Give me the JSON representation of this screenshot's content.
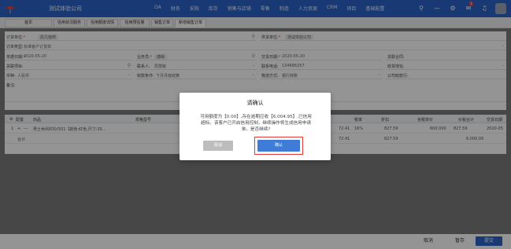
{
  "header": {
    "company": "测试体验公司",
    "nav": [
      "OA",
      "财务",
      "采购",
      "库存",
      "销售与店铺",
      "零售",
      "制造",
      "人力资源",
      "CRM",
      "项目",
      "基础配置"
    ],
    "notification_count": "1"
  },
  "tabs": [
    "首页",
    "信用状况服务",
    "信用额度详情",
    "信用预估量",
    "销售订单",
    "新增销售订单"
  ],
  "form": {
    "order_unit_label": "订货单位:",
    "order_unit_value": "凯凡拖呀",
    "supply_unit_label": "供货单位:",
    "supply_unit_value": "测试体验公司",
    "order_type_label": "订单类型:",
    "order_type_value": "标准客户订货单",
    "order_date_label": "单据日期:",
    "order_date_value": "2020-05-20",
    "salesperson_label": "业务员:",
    "salesperson_value": "傅缘",
    "delivery_date_label": "交货日期:",
    "delivery_date_value": "2020-05-20",
    "contract_label": "关联合同:",
    "project_label": "关联项目:",
    "contact_label": "联系人:",
    "contact_value": "周慧敏",
    "phone_label": "联系电话:",
    "phone_value": "134886257",
    "address_label": "收货地址:",
    "currency_label": "币种:",
    "currency_value": "人民币",
    "payment_label": "收款条件:",
    "payment_value": "下月月底结算",
    "logistics_label": "物流方式:",
    "logistics_value": "银行转账",
    "company_account_label": "公司收款行:",
    "remark_label": "备注:"
  },
  "table": {
    "settings_label": "配置",
    "headers": [
      "商品",
      "规格型号",
      "税率",
      "折扣",
      "含税单价",
      "价税合计",
      "交货日期"
    ],
    "row_index": "1",
    "product": "男士休闲衬衫(501【颜色:红色,尺寸:S5...",
    "amount_mid": "72.41",
    "tax_rate": "16%",
    "discount": "827.59",
    "unit_price": "600.000",
    "line_total": "827.59",
    "total_sum": "6,000.00",
    "delivery": "2020-05",
    "subtotal_label": "合计",
    "subtotal_mid": "72.41",
    "subtotal_discount": "827.59",
    "subtotal_total": "6,000.00"
  },
  "footer": {
    "cancel_label": "取消",
    "save_draft_label": "暂存",
    "submit_label": "提交"
  },
  "modal": {
    "title": "请确认",
    "message": "可用额度为【0.00】,存在逾期应收【6,004.95】,已信用超标。该客户已开启信用控制，继续操作将生成信用申请单。是否继续?",
    "cancel_label": "取消",
    "confirm_label": "确认"
  }
}
